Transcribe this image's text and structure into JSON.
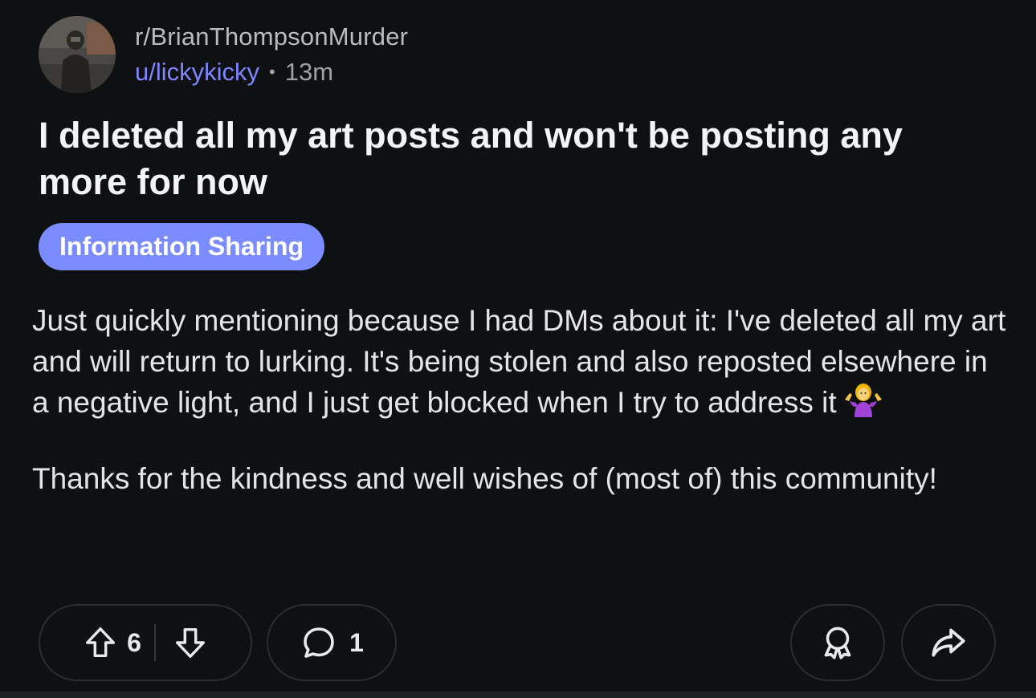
{
  "post": {
    "subreddit": "r/BrianThompsonMurder",
    "username": "u/lickykicky",
    "separator": "•",
    "time": "13m",
    "title": "I deleted all my art posts and won't be posting any more for now",
    "flair": "Information Sharing",
    "body_paragraph_1": "Just quickly mentioning because I had DMs about it: I've deleted all my art and will return to lurking. It's being stolen and also reposted elsewhere in a negative light, and I just get blocked when I try to address it",
    "body_paragraph_2": "Thanks for the kindness and well wishes of (most of) this community!"
  },
  "actions": {
    "vote_count": "6",
    "comment_count": "1"
  },
  "icons": {
    "upvote": "upvote-arrow-icon",
    "downvote": "downvote-arrow-icon",
    "comment": "comment-bubble-icon",
    "award": "award-icon",
    "share": "share-arrow-icon",
    "emoji": "woman-shrugging-emoji"
  },
  "colors": {
    "background": "#0f1012",
    "username": "#7d86ff",
    "flair_bg": "#7a8cff",
    "pill_border": "#2a2d31"
  }
}
